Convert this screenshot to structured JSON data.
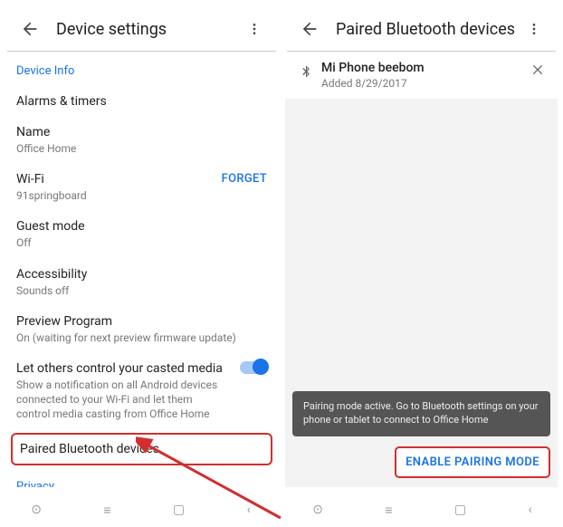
{
  "left": {
    "title": "Device settings",
    "device_info": "Device Info",
    "alarms": "Alarms & timers",
    "name_label": "Name",
    "name_value": "Office Home",
    "wifi_label": "Wi-Fi",
    "wifi_value": "91springboard",
    "wifi_forget": "FORGET",
    "guest_label": "Guest mode",
    "guest_value": "Off",
    "access_label": "Accessibility",
    "access_value": "Sounds off",
    "preview_label": "Preview Program",
    "preview_value": "On (waiting for next preview firmware update)",
    "cast_label": "Let others control your casted media",
    "cast_value": "Show a notification on all Android devices connected to your Wi-Fi and let them control media casting from Office Home",
    "paired_label": "Paired Bluetooth devices",
    "privacy": "Privacy"
  },
  "right": {
    "title": "Paired Bluetooth devices",
    "device_name": "Mi Phone beebom",
    "device_sub": "Added 8/29/2017",
    "toast": "Pairing mode active. Go to Bluetooth settings on your phone or tablet to connect to Office Home",
    "enable": "ENABLE PAIRING MODE"
  }
}
